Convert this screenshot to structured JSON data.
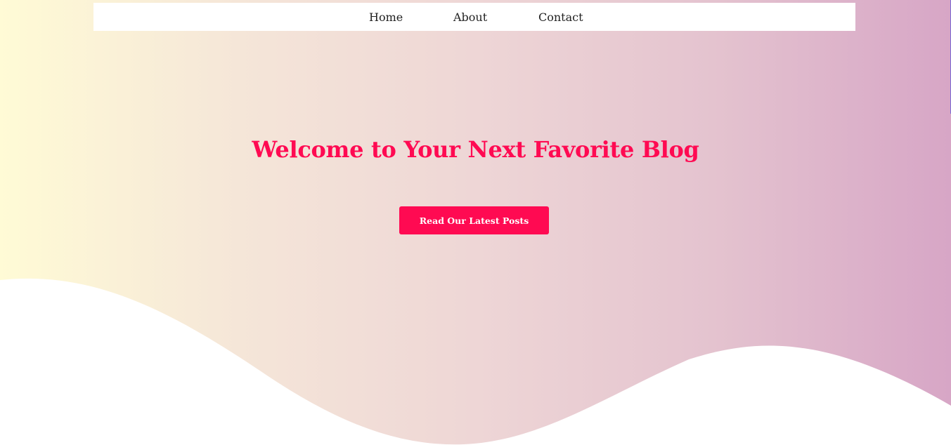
{
  "nav": {
    "items": [
      {
        "label": "Home"
      },
      {
        "label": "About"
      },
      {
        "label": "Contact"
      }
    ]
  },
  "hero": {
    "title": "Welcome to Your Next Favorite Blog",
    "cta_label": "Read Our Latest Posts"
  },
  "colors": {
    "accent": "#ff0a52",
    "gradient_start": "#fffbd6",
    "gradient_end": "#d7a6c6",
    "navbar_bg": "#ffffff",
    "wave_fill": "#ffffff"
  }
}
